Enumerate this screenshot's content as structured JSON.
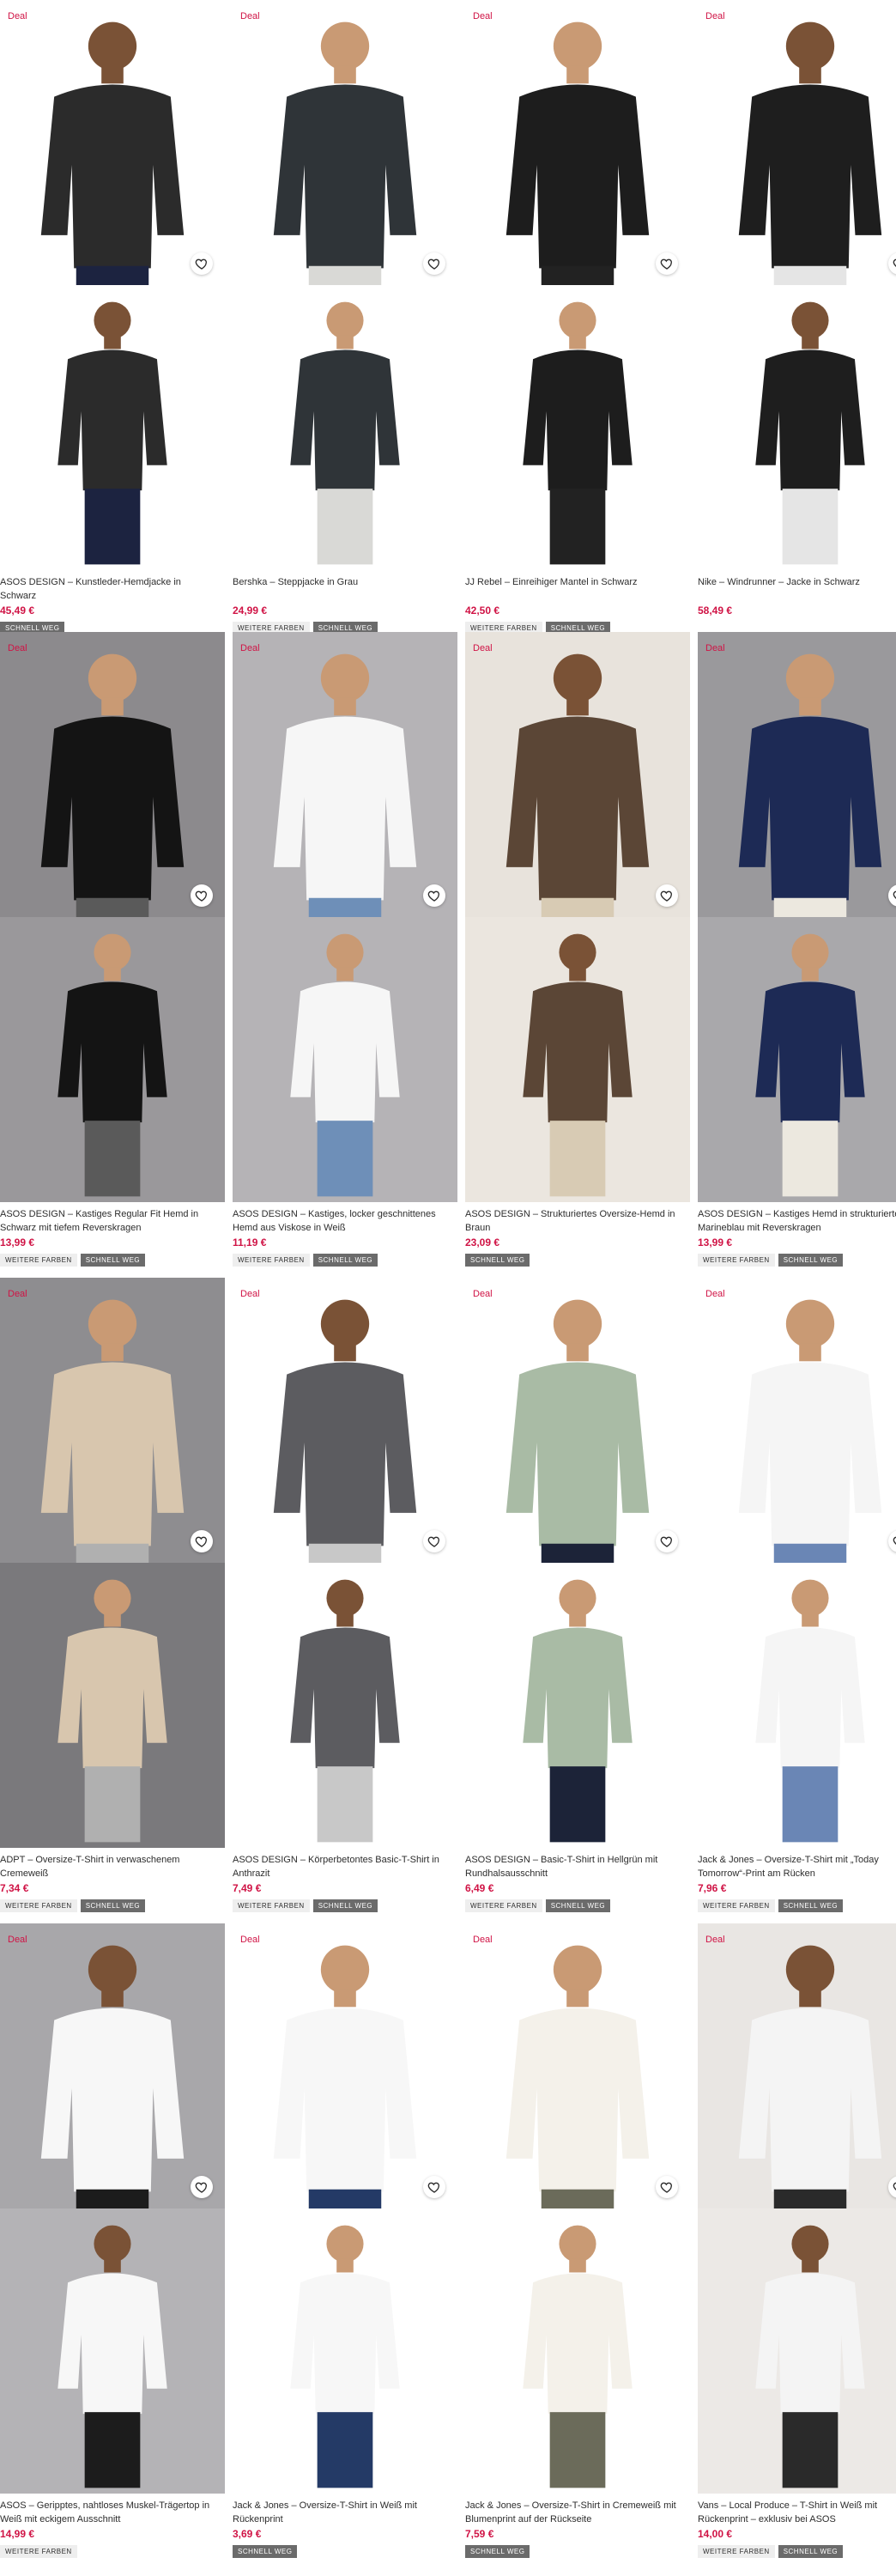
{
  "deal_label": "Deal",
  "tags": {
    "more": "WEITERE FARBEN",
    "fast": "SCHNELL WEG"
  },
  "products": [
    {
      "title": "ASOS DESIGN – Kunstleder-Hemdjacke in Schwarz",
      "price": "45,49 €",
      "more": false,
      "fast": true,
      "bg1": "#ffffff",
      "bg2": "#ffffff",
      "top": "#2b2b2b",
      "bottom": "#1c2340"
    },
    {
      "title": "Bershka – Steppjacke in Grau",
      "price": "24,99 €",
      "more": true,
      "fast": true,
      "bg1": "#ffffff",
      "bg2": "#ffffff",
      "top": "#2f3438",
      "bottom": "#d9d9d6"
    },
    {
      "title": "JJ Rebel – Einreihiger Mantel in Schwarz",
      "price": "42,50 €",
      "more": true,
      "fast": true,
      "bg1": "#ffffff",
      "bg2": "#ffffff",
      "top": "#1d1d1d",
      "bottom": "#222222"
    },
    {
      "title": "Nike – Windrunner – Jacke in Schwarz",
      "price": "58,49 €",
      "more": false,
      "fast": false,
      "bg1": "#ffffff",
      "bg2": "#ffffff",
      "top": "#1e1e1e",
      "bottom": "#e5e5e5"
    },
    {
      "title": "ASOS DESIGN – Kastiges Regular Fit Hemd in Schwarz mit tiefem Reverskragen",
      "price": "13,99 €",
      "more": true,
      "fast": true,
      "bg1": "#8c8a8d",
      "bg2": "#9a989b",
      "top": "#141414",
      "bottom": "#5a5a5a"
    },
    {
      "title": "ASOS DESIGN – Kastiges, locker geschnittenes Hemd aus Viskose in Weiß",
      "price": "11,19 €",
      "more": true,
      "fast": true,
      "bg1": "#b5b3b6",
      "bg2": "#b5b3b6",
      "top": "#f6f6f6",
      "bottom": "#6e8fb8"
    },
    {
      "title": "ASOS DESIGN – Strukturiertes Oversize-Hemd in Braun",
      "price": "23,09 €",
      "more": false,
      "fast": true,
      "bg1": "#e8e3dc",
      "bg2": "#ebe6df",
      "top": "#5b4636",
      "bottom": "#d8cbb4"
    },
    {
      "title": "ASOS DESIGN – Kastiges Hemd in strukturiertem Marineblau mit Reverskragen",
      "price": "13,99 €",
      "more": true,
      "fast": true,
      "bg1": "#9a999c",
      "bg2": "#a9a8ab",
      "top": "#1d2a55",
      "bottom": "#ece8df"
    },
    {
      "title": "ADPT – Oversize-T-Shirt in verwaschenem Cremeweiß",
      "price": "7,34 €",
      "more": true,
      "fast": true,
      "bg1": "#8e8d90",
      "bg2": "#7a797c",
      "top": "#d8c6ae",
      "bottom": "#b0b0b0"
    },
    {
      "title": "ASOS DESIGN – Körperbetontes Basic-T-Shirt in Anthrazit",
      "price": "7,49 €",
      "more": true,
      "fast": true,
      "bg1": "#ffffff",
      "bg2": "#ffffff",
      "top": "#5c5c60",
      "bottom": "#c8c8c8"
    },
    {
      "title": "ASOS DESIGN – Basic-T-Shirt in Hellgrün mit Rundhalsausschnitt",
      "price": "6,49 €",
      "more": true,
      "fast": true,
      "bg1": "#ffffff",
      "bg2": "#ffffff",
      "top": "#a9bba5",
      "bottom": "#1c2338"
    },
    {
      "title": "Jack & Jones – Oversize-T-Shirt mit „Today Tomorrow“-Print am Rücken",
      "price": "7,96 €",
      "more": true,
      "fast": true,
      "bg1": "#ffffff",
      "bg2": "#ffffff",
      "top": "#f5f5f5",
      "bottom": "#6a86b5"
    },
    {
      "title": "ASOS – Geripptes, nahtloses Muskel-Trägertop in Weiß mit eckigem Ausschnitt",
      "price": "14,99 €",
      "more": true,
      "fast": false,
      "bg1": "#a8a7aa",
      "bg2": "#b4b3b6",
      "top": "#f7f7f7",
      "bottom": "#1c1c1c"
    },
    {
      "title": "Jack & Jones – Oversize-T-Shirt in Weiß mit Rückenprint",
      "price": "3,69 €",
      "more": false,
      "fast": true,
      "bg1": "#ffffff",
      "bg2": "#ffffff",
      "top": "#f7f7f7",
      "bottom": "#243a66"
    },
    {
      "title": "Jack & Jones – Oversize-T-Shirt in Cremeweiß mit Blumenprint auf der Rückseite",
      "price": "7,59 €",
      "more": false,
      "fast": true,
      "bg1": "#ffffff",
      "bg2": "#ffffff",
      "top": "#f4f1ea",
      "bottom": "#6b6b5a"
    },
    {
      "title": "Vans – Local Produce – T-Shirt in Weiß mit Rückenprint – exklusiv bei ASOS",
      "price": "14,00 €",
      "more": true,
      "fast": true,
      "bg1": "#e9e6e3",
      "bg2": "#ece9e6",
      "top": "#f4f4f4",
      "bottom": "#2a2a2a"
    }
  ]
}
